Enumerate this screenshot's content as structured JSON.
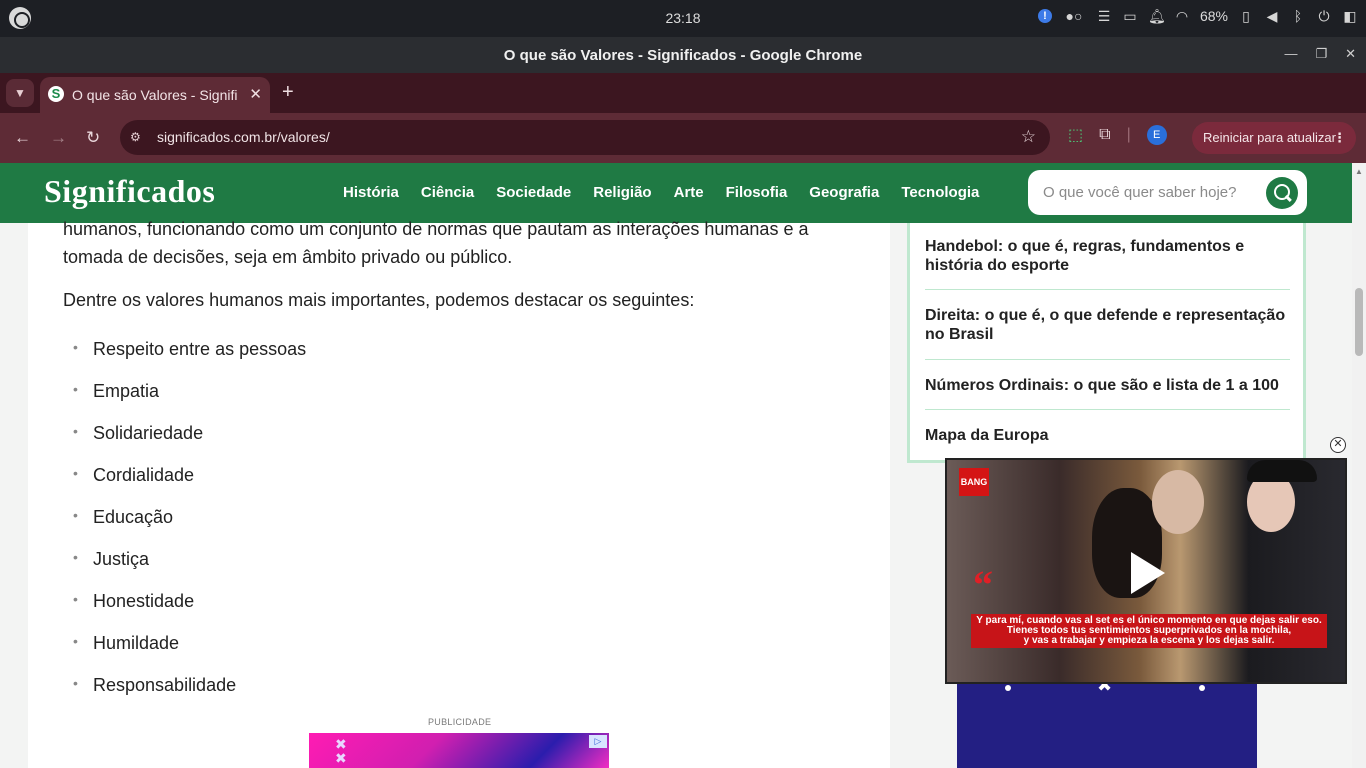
{
  "system": {
    "time": "23:18",
    "battery": "68%"
  },
  "window": {
    "title": "O que são Valores - Significados - Google Chrome"
  },
  "tab": {
    "label": "O que são Valores - Significados",
    "favicon_letter": "S"
  },
  "toolbar": {
    "url": "significados.com.br/valores/",
    "account_initial": "E",
    "restart_label": "Reiniciar para atualizar"
  },
  "site": {
    "brand": "Significados",
    "menu": [
      "História",
      "Ciência",
      "Sociedade",
      "Religião",
      "Arte",
      "Filosofia",
      "Geografia",
      "Tecnologia"
    ],
    "search_placeholder": "O que você quer saber hoje?"
  },
  "article": {
    "paragraph_top": "humanos, funcionando como um conjunto de normas que pautam as interações humanas e a tomada de decisões, seja em âmbito privado ou público.",
    "paragraph_intro": "Dentre os valores humanos mais importantes, podemos destacar os seguintes:",
    "values": [
      "Respeito entre as pessoas",
      "Empatia",
      "Solidariedade",
      "Cordialidade",
      "Educação",
      "Justiça",
      "Honestidade",
      "Humildade",
      "Responsabilidade"
    ],
    "ad_label": "PUBLICIDADE"
  },
  "sidebar": {
    "items": [
      "Handebol: o que é, regras, fundamentos e história do esporte",
      "Direita: o que é, o que defende e representação no Brasil",
      "Números Ordinais: o que são e lista de 1 a 100",
      "Mapa da Europa"
    ]
  },
  "video": {
    "logo": "BANG",
    "subtitle_lines": [
      "Y para mí, cuando vas al set es el único momento en que dejas salir eso.",
      "Tienes todos tus sentimientos superprivados en la mochila,",
      "y vas a trabajar y empieza la escena y los dejas salir."
    ]
  }
}
